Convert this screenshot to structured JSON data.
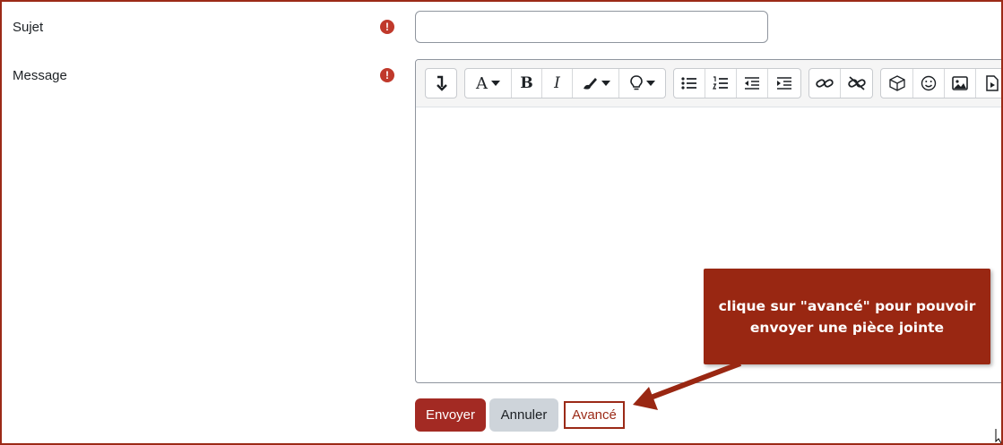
{
  "form": {
    "subject_label": "Sujet",
    "message_label": "Message",
    "required_marker": "!",
    "subject_value": ""
  },
  "toolbar": {
    "icons": [
      "undo-redo-icon",
      "font-icon",
      "bold-icon",
      "italic-icon",
      "brush-icon",
      "lightbulb-icon",
      "unordered-list-icon",
      "ordered-list-icon",
      "outdent-icon",
      "indent-icon",
      "link-icon",
      "unlink-icon",
      "media-icon",
      "emoji-icon",
      "image-icon",
      "file-icon"
    ]
  },
  "actions": {
    "submit_label": "Envoyer",
    "cancel_label": "Annuler",
    "advanced_label": "Avancé"
  },
  "callout": {
    "line1": "clique sur \"avancé\" pour pouvoir",
    "line2": "envoyer une pièce jointe"
  },
  "colors": {
    "accent": "#a32a23",
    "callout": "#992712",
    "frame": "#9b2a17",
    "required": "#c0392b"
  }
}
